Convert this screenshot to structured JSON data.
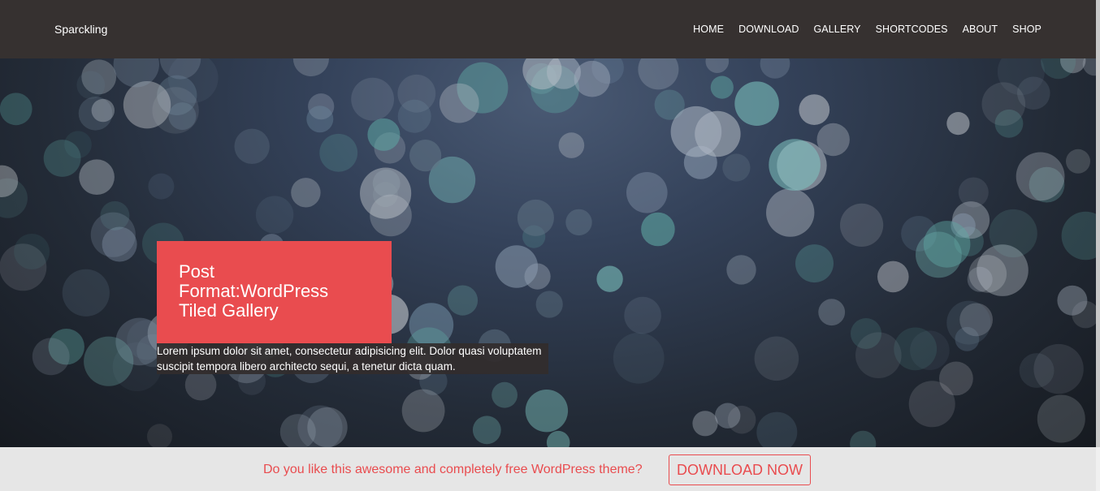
{
  "header": {
    "brand": "Sparckling",
    "nav": [
      "HOME",
      "DOWNLOAD",
      "GALLERY",
      "SHORTCODES",
      "ABOUT",
      "SHOP"
    ]
  },
  "hero": {
    "post_title": "Post Format:WordPress Tiled Gallery",
    "excerpt": "Lorem ipsum dolor sit amet, consectetur adipisicing elit. Dolor quasi voluptatem suscipit tempora libero architecto sequi, a tenetur dicta quam."
  },
  "promo": {
    "text": "Do you like this awesome and completely free WordPress theme?",
    "button_label": "DOWNLOAD NOW"
  },
  "colors": {
    "accent": "#e94c4f",
    "header_bg": "#363130",
    "promo_bg": "#e6e6e6"
  }
}
